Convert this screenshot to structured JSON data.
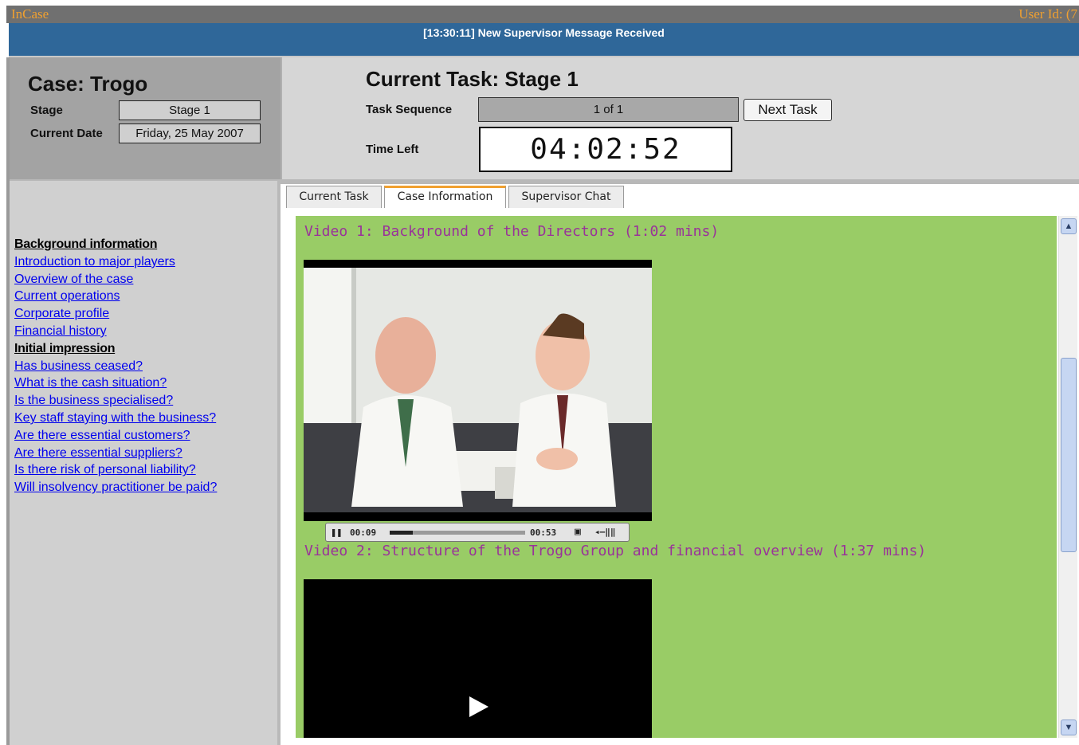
{
  "app": {
    "title": "InCase",
    "user_label": "User Id: (7"
  },
  "notification": {
    "text": "[13:30:11] New Supervisor Message Received"
  },
  "case": {
    "title": "Case: Trogo",
    "stage_label": "Stage",
    "stage_value": "Stage 1",
    "date_label": "Current Date",
    "date_value": "Friday, 25 May 2007"
  },
  "task": {
    "title": "Current Task: Stage 1",
    "sequence_label": "Task Sequence",
    "sequence_value": "1 of 1",
    "next_button": "Next Task",
    "time_left_label": "Time Left",
    "time_left_value": "04:02:52"
  },
  "nav": {
    "items": [
      {
        "label": "Background information",
        "type": "heading"
      },
      {
        "label": "Introduction to major players",
        "type": "link"
      },
      {
        "label": "Overview of the case",
        "type": "link"
      },
      {
        "label": "Current operations",
        "type": "link"
      },
      {
        "label": "Corporate profile",
        "type": "link"
      },
      {
        "label": "Financial history",
        "type": "link"
      },
      {
        "label": "Initial impression",
        "type": "heading"
      },
      {
        "label": "Has business ceased?",
        "type": "link"
      },
      {
        "label": "What is the cash situation?",
        "type": "link"
      },
      {
        "label": "Is the business specialised?",
        "type": "link"
      },
      {
        "label": "Key staff staying with the business?",
        "type": "link"
      },
      {
        "label": "Are there essential customers?",
        "type": "link"
      },
      {
        "label": "Are there essential suppliers?",
        "type": "link"
      },
      {
        "label": "Is there risk of personal liability?",
        "type": "link"
      },
      {
        "label": "Will insolvency practitioner be paid?",
        "type": "link"
      }
    ]
  },
  "tabs": [
    {
      "label": "Current Task",
      "active": false
    },
    {
      "label": "Case Information",
      "active": true
    },
    {
      "label": "Supervisor Chat",
      "active": false
    }
  ],
  "content": {
    "video1": {
      "title": "Video 1: Background of the Directors (1:02 mins)",
      "elapsed": "00:09",
      "duration": "00:53",
      "progress_fraction": 0.17
    },
    "video2": {
      "title": "Video 2: Structure of the Trogo Group and financial overview (1:37 mins)"
    }
  },
  "colors": {
    "accent": "#f0a030",
    "header_blue": "#2f6799",
    "content_green": "#99cc66",
    "video_title": "#993399",
    "link": "#0000ee"
  }
}
